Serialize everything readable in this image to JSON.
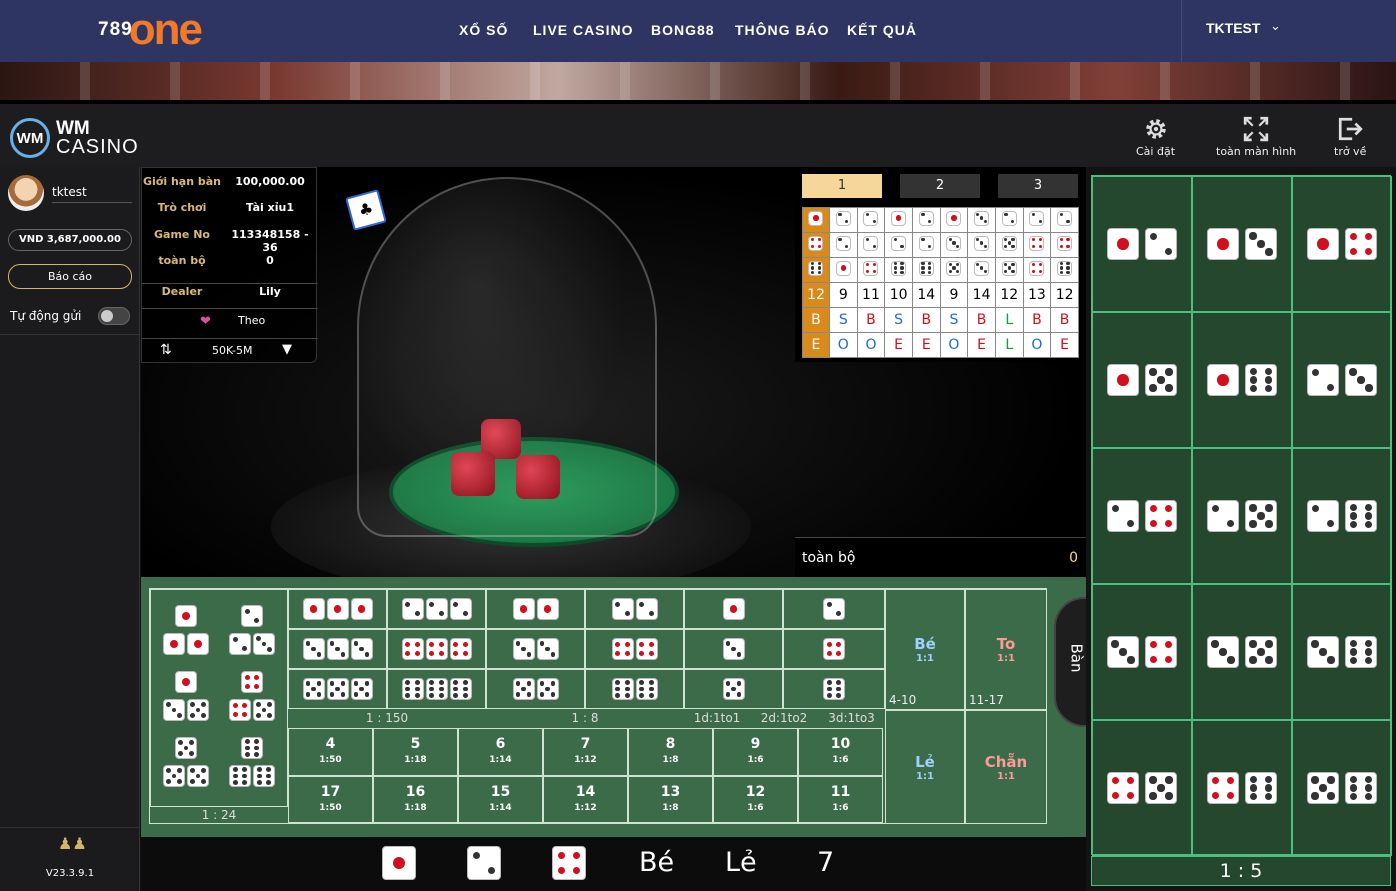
{
  "site": {
    "logo_num": "789",
    "logo_word": "one",
    "nav": [
      "XỔ SỐ",
      "LIVE CASINO",
      "BONG88",
      "THÔNG BÁO",
      "KẾT QUẢ"
    ],
    "username": "TKTEST"
  },
  "casino": {
    "logo_mark": "WM",
    "logo_line1": "WM",
    "logo_line2": "CASINO",
    "tools": [
      "Cài đặt",
      "toàn màn hình",
      "trở về"
    ]
  },
  "sidebar": {
    "player": "tktest",
    "balance": "VND 3,687,000.00",
    "report": "Báo cáo",
    "auto_label": "Tự động gửi",
    "version": "V23.3.9.1"
  },
  "table_info": {
    "rows": [
      {
        "k": "Giới hạn bàn",
        "v": "100,000.00"
      },
      {
        "k": "Trò chơi",
        "v": "Tài xỉu1"
      },
      {
        "k": "Game No",
        "v": "113348158 - 36"
      },
      {
        "k": "toàn bộ",
        "v": "0"
      },
      {
        "k": "Dealer",
        "v": "Lily"
      }
    ],
    "follow": "Theo",
    "bet_range": "50K-5M"
  },
  "roadmap": {
    "tabs": [
      "1",
      "2",
      "3"
    ],
    "dice_rows": [
      [
        1,
        2,
        2,
        1,
        2,
        1,
        3,
        2,
        2,
        2
      ],
      [
        4,
        2,
        2,
        2,
        2,
        3,
        3,
        5,
        4,
        4
      ],
      [
        6,
        1,
        4,
        6,
        6,
        5,
        3,
        5,
        4,
        6
      ]
    ],
    "sums": [
      "9",
      "11",
      "10",
      "14",
      "9",
      "14",
      "12",
      "13",
      "12"
    ],
    "sum_head": "12",
    "bs_head": "B",
    "bs": [
      "S",
      "B",
      "S",
      "B",
      "S",
      "B",
      "L",
      "B",
      "B"
    ],
    "eo_head": "E",
    "eo": [
      "O",
      "O",
      "E",
      "E",
      "O",
      "E",
      "L",
      "O",
      "E"
    ],
    "total_label": "toàn bộ",
    "total_value": "0"
  },
  "bet_board": {
    "pair_ratio": "1 : 24",
    "triple_ratio": "1 : 150",
    "double_ratio": "1 : 8",
    "single_ratios": [
      "1d:1to1",
      "2d:1to2",
      "3d:1to3"
    ],
    "small": {
      "name": "Bé",
      "ratio": "1:1",
      "range": "4-10"
    },
    "big": {
      "name": "To",
      "ratio": "1:1",
      "range": "11-17"
    },
    "odd": {
      "name": "Lẻ",
      "ratio": "1:1"
    },
    "even": {
      "name": "Chẵn",
      "ratio": "1:1"
    },
    "sums_top": [
      {
        "n": "4",
        "r": "1:50"
      },
      {
        "n": "5",
        "r": "1:18"
      },
      {
        "n": "6",
        "r": "1:14"
      },
      {
        "n": "7",
        "r": "1:12"
      },
      {
        "n": "8",
        "r": "1:8"
      },
      {
        "n": "9",
        "r": "1:6"
      },
      {
        "n": "10",
        "r": "1:6"
      }
    ],
    "sums_bottom": [
      {
        "n": "17",
        "r": "1:50"
      },
      {
        "n": "16",
        "r": "1:18"
      },
      {
        "n": "15",
        "r": "1:14"
      },
      {
        "n": "14",
        "r": "1:12"
      },
      {
        "n": "13",
        "r": "1:8"
      },
      {
        "n": "12",
        "r": "1:6"
      },
      {
        "n": "11",
        "r": "1:6"
      }
    ],
    "table_button": "Bàn"
  },
  "last_result": {
    "dice": [
      1,
      2,
      4
    ],
    "size": "Bé",
    "parity": "Lẻ",
    "total": "7"
  },
  "combos": {
    "pairs": [
      [
        1,
        2
      ],
      [
        1,
        3
      ],
      [
        1,
        4
      ],
      [
        1,
        5
      ],
      [
        1,
        6
      ],
      [
        2,
        3
      ],
      [
        2,
        4
      ],
      [
        2,
        5
      ],
      [
        2,
        6
      ],
      [
        3,
        4
      ],
      [
        3,
        5
      ],
      [
        3,
        6
      ],
      [
        4,
        5
      ],
      [
        4,
        6
      ],
      [
        5,
        6
      ]
    ],
    "ratio": "1 : 5"
  },
  "colors": {
    "nav_bg": "#2f3562",
    "logo_orange": "#f07a2a",
    "board_green": "#3b6b48",
    "panel_green": "#24472e",
    "pip_red": "#d0101c",
    "tab_active": "#f6d69a"
  }
}
